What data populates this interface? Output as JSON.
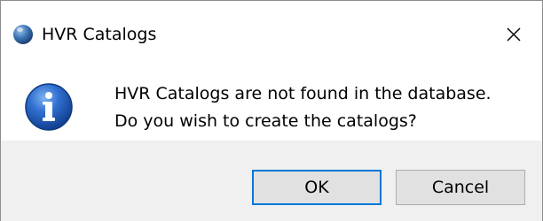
{
  "window": {
    "title": "HVR Catalogs",
    "close_symbol": "✕"
  },
  "icons": {
    "app": "hvr-app-icon",
    "info": "information-icon",
    "info_color": "#1f5fb8"
  },
  "message": {
    "line1": "HVR Catalogs are not found in the database.",
    "line2": "Do you wish to create the catalogs?"
  },
  "buttons": {
    "ok_label": "OK",
    "cancel_label": "Cancel",
    "default_accent": "#0078d7"
  }
}
